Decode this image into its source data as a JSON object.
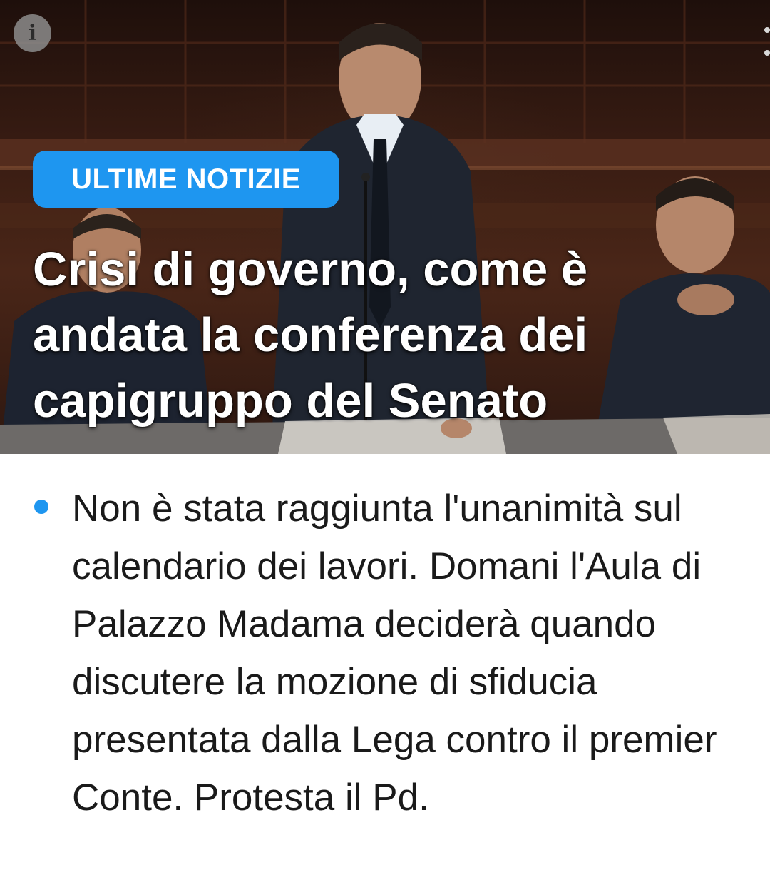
{
  "hero": {
    "info_icon": "info-icon",
    "info_glyph": "i",
    "more_icon": "more-vertical-icon",
    "badge": "ULTIME NOTIZIE",
    "headline": "Crisi di governo, come è andata la conferenza dei capigruppo del Senato"
  },
  "summary": {
    "bullet_icon": "bullet-dot-icon",
    "text": "Non è stata raggiunta l'unanimità sul calendario dei lavori. Domani l'Aula di Palazzo Madama deciderà quando discutere la mozione di sfiducia presentata dalla Lega contro il premier Conte. Protesta il Pd."
  },
  "colors": {
    "accent": "#1e96f0",
    "headline_text": "#ffffff",
    "body_text": "#1a1a1a"
  }
}
